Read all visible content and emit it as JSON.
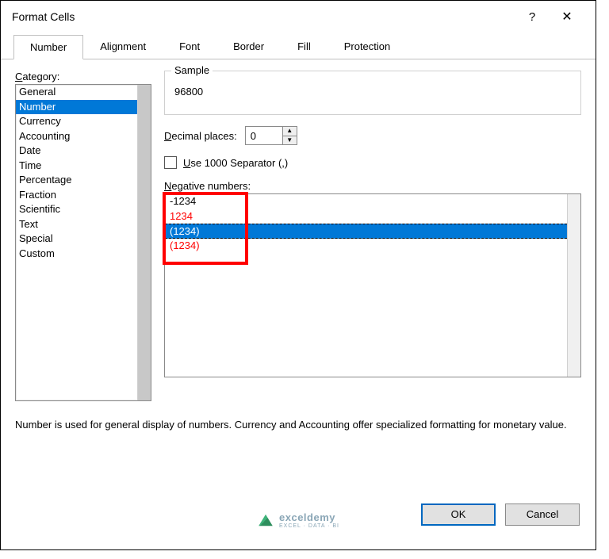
{
  "titlebar": {
    "title": "Format Cells",
    "help": "?",
    "close": "✕"
  },
  "tabs": [
    "Number",
    "Alignment",
    "Font",
    "Border",
    "Fill",
    "Protection"
  ],
  "tabs_active_index": 0,
  "category": {
    "label_pre": "",
    "label_u": "C",
    "label_post": "ategory:",
    "items": [
      "General",
      "Number",
      "Currency",
      "Accounting",
      "Date",
      "Time",
      "Percentage",
      "Fraction",
      "Scientific",
      "Text",
      "Special",
      "Custom"
    ],
    "selected_index": 1
  },
  "sample": {
    "label": "Sample",
    "value": "96800"
  },
  "decimal": {
    "label_u": "D",
    "label_post": "ecimal places:",
    "value": "0"
  },
  "separator": {
    "label_u": "U",
    "label_post": "se 1000 Separator (,)"
  },
  "negative": {
    "label_u": "N",
    "label_post": "egative numbers:",
    "items": [
      {
        "text": "-1234",
        "red": false
      },
      {
        "text": "1234",
        "red": true
      },
      {
        "text": "(1234)",
        "red": false,
        "selected": true
      },
      {
        "text": "(1234)",
        "red": true
      }
    ]
  },
  "description": "Number is used for general display of numbers.  Currency and Accounting offer specialized formatting for monetary value.",
  "buttons": {
    "ok": "OK",
    "cancel": "Cancel"
  },
  "logo_text": "exceldemy",
  "logo_sub": "EXCEL · DATA · BI"
}
